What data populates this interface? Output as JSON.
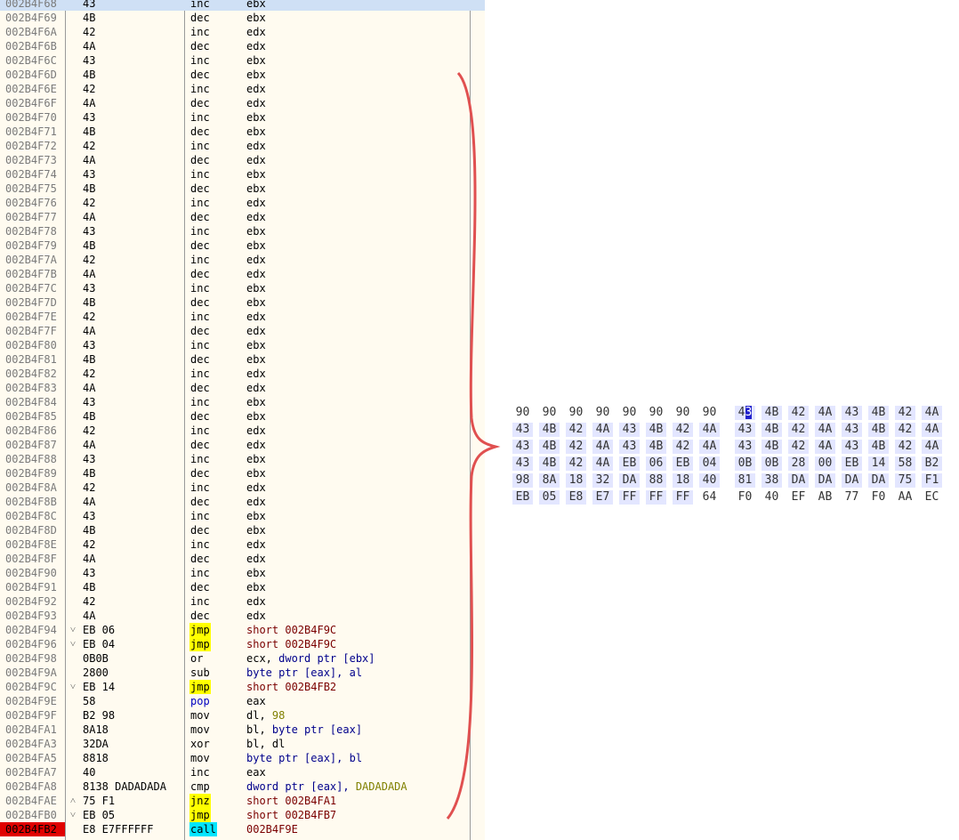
{
  "colors": {
    "disasm_bg": "#fffbf0",
    "jmp_highlight": "#ffff00",
    "call_highlight": "#00e5ff",
    "current_address_bg": "#e00000",
    "hex_highlight": "#e3e6ff",
    "bracket": "#e05050"
  },
  "disassembly": [
    {
      "addr": "002B4F68",
      "hex": "43",
      "mnem": "inc",
      "ops": [
        {
          "t": "ebx",
          "c": "plain"
        }
      ],
      "sel": true
    },
    {
      "addr": "002B4F69",
      "hex": "4B",
      "mnem": "dec",
      "ops": [
        {
          "t": "ebx",
          "c": "plain"
        }
      ]
    },
    {
      "addr": "002B4F6A",
      "hex": "42",
      "mnem": "inc",
      "ops": [
        {
          "t": "edx",
          "c": "plain"
        }
      ]
    },
    {
      "addr": "002B4F6B",
      "hex": "4A",
      "mnem": "dec",
      "ops": [
        {
          "t": "edx",
          "c": "plain"
        }
      ]
    },
    {
      "addr": "002B4F6C",
      "hex": "43",
      "mnem": "inc",
      "ops": [
        {
          "t": "ebx",
          "c": "plain"
        }
      ]
    },
    {
      "addr": "002B4F6D",
      "hex": "4B",
      "mnem": "dec",
      "ops": [
        {
          "t": "ebx",
          "c": "plain"
        }
      ]
    },
    {
      "addr": "002B4F6E",
      "hex": "42",
      "mnem": "inc",
      "ops": [
        {
          "t": "edx",
          "c": "plain"
        }
      ]
    },
    {
      "addr": "002B4F6F",
      "hex": "4A",
      "mnem": "dec",
      "ops": [
        {
          "t": "edx",
          "c": "plain"
        }
      ]
    },
    {
      "addr": "002B4F70",
      "hex": "43",
      "mnem": "inc",
      "ops": [
        {
          "t": "ebx",
          "c": "plain"
        }
      ]
    },
    {
      "addr": "002B4F71",
      "hex": "4B",
      "mnem": "dec",
      "ops": [
        {
          "t": "ebx",
          "c": "plain"
        }
      ]
    },
    {
      "addr": "002B4F72",
      "hex": "42",
      "mnem": "inc",
      "ops": [
        {
          "t": "edx",
          "c": "plain"
        }
      ]
    },
    {
      "addr": "002B4F73",
      "hex": "4A",
      "mnem": "dec",
      "ops": [
        {
          "t": "edx",
          "c": "plain"
        }
      ]
    },
    {
      "addr": "002B4F74",
      "hex": "43",
      "mnem": "inc",
      "ops": [
        {
          "t": "ebx",
          "c": "plain"
        }
      ]
    },
    {
      "addr": "002B4F75",
      "hex": "4B",
      "mnem": "dec",
      "ops": [
        {
          "t": "ebx",
          "c": "plain"
        }
      ]
    },
    {
      "addr": "002B4F76",
      "hex": "42",
      "mnem": "inc",
      "ops": [
        {
          "t": "edx",
          "c": "plain"
        }
      ]
    },
    {
      "addr": "002B4F77",
      "hex": "4A",
      "mnem": "dec",
      "ops": [
        {
          "t": "edx",
          "c": "plain"
        }
      ]
    },
    {
      "addr": "002B4F78",
      "hex": "43",
      "mnem": "inc",
      "ops": [
        {
          "t": "ebx",
          "c": "plain"
        }
      ]
    },
    {
      "addr": "002B4F79",
      "hex": "4B",
      "mnem": "dec",
      "ops": [
        {
          "t": "ebx",
          "c": "plain"
        }
      ]
    },
    {
      "addr": "002B4F7A",
      "hex": "42",
      "mnem": "inc",
      "ops": [
        {
          "t": "edx",
          "c": "plain"
        }
      ]
    },
    {
      "addr": "002B4F7B",
      "hex": "4A",
      "mnem": "dec",
      "ops": [
        {
          "t": "edx",
          "c": "plain"
        }
      ]
    },
    {
      "addr": "002B4F7C",
      "hex": "43",
      "mnem": "inc",
      "ops": [
        {
          "t": "ebx",
          "c": "plain"
        }
      ]
    },
    {
      "addr": "002B4F7D",
      "hex": "4B",
      "mnem": "dec",
      "ops": [
        {
          "t": "ebx",
          "c": "plain"
        }
      ]
    },
    {
      "addr": "002B4F7E",
      "hex": "42",
      "mnem": "inc",
      "ops": [
        {
          "t": "edx",
          "c": "plain"
        }
      ]
    },
    {
      "addr": "002B4F7F",
      "hex": "4A",
      "mnem": "dec",
      "ops": [
        {
          "t": "edx",
          "c": "plain"
        }
      ]
    },
    {
      "addr": "002B4F80",
      "hex": "43",
      "mnem": "inc",
      "ops": [
        {
          "t": "ebx",
          "c": "plain"
        }
      ]
    },
    {
      "addr": "002B4F81",
      "hex": "4B",
      "mnem": "dec",
      "ops": [
        {
          "t": "ebx",
          "c": "plain"
        }
      ]
    },
    {
      "addr": "002B4F82",
      "hex": "42",
      "mnem": "inc",
      "ops": [
        {
          "t": "edx",
          "c": "plain"
        }
      ]
    },
    {
      "addr": "002B4F83",
      "hex": "4A",
      "mnem": "dec",
      "ops": [
        {
          "t": "edx",
          "c": "plain"
        }
      ]
    },
    {
      "addr": "002B4F84",
      "hex": "43",
      "mnem": "inc",
      "ops": [
        {
          "t": "ebx",
          "c": "plain"
        }
      ]
    },
    {
      "addr": "002B4F85",
      "hex": "4B",
      "mnem": "dec",
      "ops": [
        {
          "t": "ebx",
          "c": "plain"
        }
      ]
    },
    {
      "addr": "002B4F86",
      "hex": "42",
      "mnem": "inc",
      "ops": [
        {
          "t": "edx",
          "c": "plain"
        }
      ]
    },
    {
      "addr": "002B4F87",
      "hex": "4A",
      "mnem": "dec",
      "ops": [
        {
          "t": "edx",
          "c": "plain"
        }
      ]
    },
    {
      "addr": "002B4F88",
      "hex": "43",
      "mnem": "inc",
      "ops": [
        {
          "t": "ebx",
          "c": "plain"
        }
      ]
    },
    {
      "addr": "002B4F89",
      "hex": "4B",
      "mnem": "dec",
      "ops": [
        {
          "t": "ebx",
          "c": "plain"
        }
      ]
    },
    {
      "addr": "002B4F8A",
      "hex": "42",
      "mnem": "inc",
      "ops": [
        {
          "t": "edx",
          "c": "plain"
        }
      ]
    },
    {
      "addr": "002B4F8B",
      "hex": "4A",
      "mnem": "dec",
      "ops": [
        {
          "t": "edx",
          "c": "plain"
        }
      ]
    },
    {
      "addr": "002B4F8C",
      "hex": "43",
      "mnem": "inc",
      "ops": [
        {
          "t": "ebx",
          "c": "plain"
        }
      ]
    },
    {
      "addr": "002B4F8D",
      "hex": "4B",
      "mnem": "dec",
      "ops": [
        {
          "t": "ebx",
          "c": "plain"
        }
      ]
    },
    {
      "addr": "002B4F8E",
      "hex": "42",
      "mnem": "inc",
      "ops": [
        {
          "t": "edx",
          "c": "plain"
        }
      ]
    },
    {
      "addr": "002B4F8F",
      "hex": "4A",
      "mnem": "dec",
      "ops": [
        {
          "t": "edx",
          "c": "plain"
        }
      ]
    },
    {
      "addr": "002B4F90",
      "hex": "43",
      "mnem": "inc",
      "ops": [
        {
          "t": "ebx",
          "c": "plain"
        }
      ]
    },
    {
      "addr": "002B4F91",
      "hex": "4B",
      "mnem": "dec",
      "ops": [
        {
          "t": "ebx",
          "c": "plain"
        }
      ]
    },
    {
      "addr": "002B4F92",
      "hex": "42",
      "mnem": "inc",
      "ops": [
        {
          "t": "edx",
          "c": "plain"
        }
      ]
    },
    {
      "addr": "002B4F93",
      "hex": "4A",
      "mnem": "dec",
      "ops": [
        {
          "t": "edx",
          "c": "plain"
        }
      ]
    },
    {
      "addr": "002B4F94",
      "arrow": "down",
      "hex": "EB 06",
      "mnem": "jmp",
      "hl": "jmp",
      "ops": [
        {
          "t": "short 002B4F9C",
          "c": "lbl"
        }
      ]
    },
    {
      "addr": "002B4F96",
      "arrow": "down",
      "hex": "EB 04",
      "mnem": "jmp",
      "hl": "jmp",
      "ops": [
        {
          "t": "short 002B4F9C",
          "c": "lbl"
        }
      ]
    },
    {
      "addr": "002B4F98",
      "hex": "0B0B",
      "mnem": "or",
      "ops": [
        {
          "t": "ecx, ",
          "c": "plain"
        },
        {
          "t": "dword ptr",
          "c": "kw"
        },
        {
          "t": " [ebx]",
          "c": "kw"
        }
      ]
    },
    {
      "addr": "002B4F9A",
      "hex": "2800",
      "mnem": "sub",
      "ops": [
        {
          "t": "byte ptr [eax], al",
          "c": "kw"
        }
      ]
    },
    {
      "addr": "002B4F9C",
      "arrow": "down",
      "hex": "EB 14",
      "mnem": "jmp",
      "hl": "jmp",
      "ops": [
        {
          "t": "short 002B4FB2",
          "c": "lbl"
        }
      ]
    },
    {
      "addr": "002B4F9E",
      "hex": "58",
      "mnem": "pop",
      "hl": "pop",
      "ops": [
        {
          "t": "eax",
          "c": "plain"
        }
      ]
    },
    {
      "addr": "002B4F9F",
      "hex": "B2 98",
      "mnem": "mov",
      "ops": [
        {
          "t": "dl, ",
          "c": "plain"
        },
        {
          "t": "98",
          "c": "num"
        }
      ]
    },
    {
      "addr": "002B4FA1",
      "hex": "8A18",
      "mnem": "mov",
      "ops": [
        {
          "t": "bl, ",
          "c": "plain"
        },
        {
          "t": "byte ptr [eax]",
          "c": "kw"
        }
      ]
    },
    {
      "addr": "002B4FA3",
      "hex": "32DA",
      "mnem": "xor",
      "ops": [
        {
          "t": "bl, dl",
          "c": "plain"
        }
      ]
    },
    {
      "addr": "002B4FA5",
      "hex": "8818",
      "mnem": "mov",
      "ops": [
        {
          "t": "byte ptr [eax], bl",
          "c": "kw"
        }
      ]
    },
    {
      "addr": "002B4FA7",
      "hex": "40",
      "mnem": "inc",
      "ops": [
        {
          "t": "eax",
          "c": "plain"
        }
      ]
    },
    {
      "addr": "002B4FA8",
      "hex": "8138 DADADADA",
      "mnem": "cmp",
      "ops": [
        {
          "t": "dword ptr [eax], ",
          "c": "kw"
        },
        {
          "t": "DADADADA",
          "c": "num"
        }
      ]
    },
    {
      "addr": "002B4FAE",
      "arrow": "up",
      "hex": "75 F1",
      "mnem": "jnz",
      "hl": "jmp",
      "ops": [
        {
          "t": "short 002B4FA1",
          "c": "lbl"
        }
      ]
    },
    {
      "addr": "002B4FB0",
      "arrow": "down",
      "hex": "EB 05",
      "mnem": "jmp",
      "hl": "jmp",
      "ops": [
        {
          "t": "short 002B4FB7",
          "c": "lbl"
        }
      ]
    },
    {
      "addr": "002B4FB2",
      "hex": "E8 E7FFFFFF",
      "mnem": "call",
      "hl": "call",
      "cur": true,
      "ops": [
        {
          "t": "002B4F9E",
          "c": "lbl"
        }
      ]
    }
  ],
  "hexdump": {
    "rows": [
      [
        "90",
        "90",
        "90",
        "90",
        "90",
        "90",
        "90",
        "90",
        "43",
        "4B",
        "42",
        "4A",
        "43",
        "4B",
        "42",
        "4A"
      ],
      [
        "43",
        "4B",
        "42",
        "4A",
        "43",
        "4B",
        "42",
        "4A",
        "43",
        "4B",
        "42",
        "4A",
        "43",
        "4B",
        "42",
        "4A"
      ],
      [
        "43",
        "4B",
        "42",
        "4A",
        "43",
        "4B",
        "42",
        "4A",
        "43",
        "4B",
        "42",
        "4A",
        "43",
        "4B",
        "42",
        "4A"
      ],
      [
        "43",
        "4B",
        "42",
        "4A",
        "EB",
        "06",
        "EB",
        "04",
        "0B",
        "0B",
        "28",
        "00",
        "EB",
        "14",
        "58",
        "B2"
      ],
      [
        "98",
        "8A",
        "18",
        "32",
        "DA",
        "88",
        "18",
        "40",
        "81",
        "38",
        "DA",
        "DA",
        "DA",
        "DA",
        "75",
        "F1"
      ],
      [
        "EB",
        "05",
        "E8",
        "E7",
        "FF",
        "FF",
        "FF",
        "64",
        "F0",
        "40",
        "EF",
        "AB",
        "77",
        "F0",
        "AA",
        "EC"
      ]
    ],
    "highlighted": [
      [
        false,
        false,
        false,
        false,
        false,
        false,
        false,
        false,
        true,
        true,
        true,
        true,
        true,
        true,
        true,
        true
      ],
      [
        true,
        true,
        true,
        true,
        true,
        true,
        true,
        true,
        true,
        true,
        true,
        true,
        true,
        true,
        true,
        true
      ],
      [
        true,
        true,
        true,
        true,
        true,
        true,
        true,
        true,
        true,
        true,
        true,
        true,
        true,
        true,
        true,
        true
      ],
      [
        true,
        true,
        true,
        true,
        true,
        true,
        true,
        true,
        true,
        true,
        true,
        true,
        true,
        true,
        true,
        true
      ],
      [
        true,
        true,
        true,
        true,
        true,
        true,
        true,
        true,
        true,
        true,
        true,
        true,
        true,
        true,
        true,
        true
      ],
      [
        true,
        true,
        true,
        true,
        true,
        true,
        true,
        false,
        false,
        false,
        false,
        false,
        false,
        false,
        false,
        false
      ]
    ],
    "cursor": {
      "row": 0,
      "col": 8
    }
  }
}
